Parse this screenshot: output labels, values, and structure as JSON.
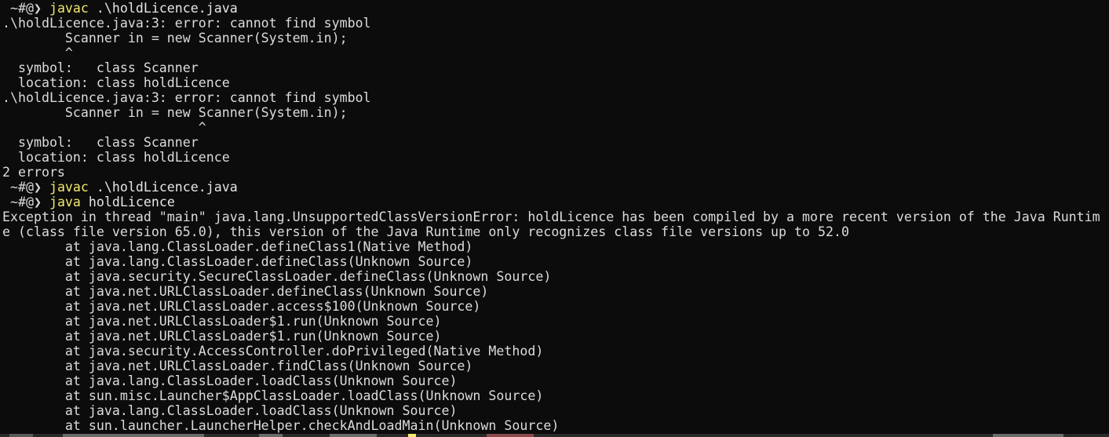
{
  "colors": {
    "background": "#0c0c0c",
    "text": "#dcdcdc",
    "command": "#f2e86b"
  },
  "terminal": {
    "lines": [
      {
        "type": "prompt",
        "prompt": " ~#@❯ ",
        "cmd": "javac",
        "args": " .\\holdLicence.java"
      },
      {
        "type": "out",
        "text": ".\\holdLicence.java:3: error: cannot find symbol"
      },
      {
        "type": "out",
        "text": "        Scanner in = new Scanner(System.in);"
      },
      {
        "type": "out",
        "text": "        ^"
      },
      {
        "type": "out",
        "text": "  symbol:   class Scanner"
      },
      {
        "type": "out",
        "text": "  location: class holdLicence"
      },
      {
        "type": "out",
        "text": ".\\holdLicence.java:3: error: cannot find symbol"
      },
      {
        "type": "out",
        "text": "        Scanner in = new Scanner(System.in);"
      },
      {
        "type": "out",
        "text": "                         ^"
      },
      {
        "type": "out",
        "text": "  symbol:   class Scanner"
      },
      {
        "type": "out",
        "text": "  location: class holdLicence"
      },
      {
        "type": "out",
        "text": "2 errors"
      },
      {
        "type": "prompt",
        "prompt": " ~#@❯ ",
        "cmd": "javac",
        "args": " .\\holdLicence.java"
      },
      {
        "type": "prompt",
        "prompt": " ~#@❯ ",
        "cmd": "java",
        "args": " holdLicence"
      },
      {
        "type": "out",
        "text": "Exception in thread \"main\" java.lang.UnsupportedClassVersionError: holdLicence has been compiled by a more recent version of the Java Runtim"
      },
      {
        "type": "out",
        "text": "e (class file version 65.0), this version of the Java Runtime only recognizes class file versions up to 52.0"
      },
      {
        "type": "out",
        "text": "        at java.lang.ClassLoader.defineClass1(Native Method)"
      },
      {
        "type": "out",
        "text": "        at java.lang.ClassLoader.defineClass(Unknown Source)"
      },
      {
        "type": "out",
        "text": "        at java.security.SecureClassLoader.defineClass(Unknown Source)"
      },
      {
        "type": "out",
        "text": "        at java.net.URLClassLoader.defineClass(Unknown Source)"
      },
      {
        "type": "out",
        "text": "        at java.net.URLClassLoader.access$100(Unknown Source)"
      },
      {
        "type": "out",
        "text": "        at java.net.URLClassLoader$1.run(Unknown Source)"
      },
      {
        "type": "out",
        "text": "        at java.net.URLClassLoader$1.run(Unknown Source)"
      },
      {
        "type": "out",
        "text": "        at java.security.AccessController.doPrivileged(Native Method)"
      },
      {
        "type": "out",
        "text": "        at java.net.URLClassLoader.findClass(Unknown Source)"
      },
      {
        "type": "out",
        "text": "        at java.lang.ClassLoader.loadClass(Unknown Source)"
      },
      {
        "type": "out",
        "text": "        at sun.misc.Launcher$AppClassLoader.loadClass(Unknown Source)"
      },
      {
        "type": "out",
        "text": "        at java.lang.ClassLoader.loadClass(Unknown Source)"
      },
      {
        "type": "out",
        "text": "        at sun.launcher.LauncherHelper.checkAndLoadMain(Unknown Source)"
      }
    ]
  }
}
